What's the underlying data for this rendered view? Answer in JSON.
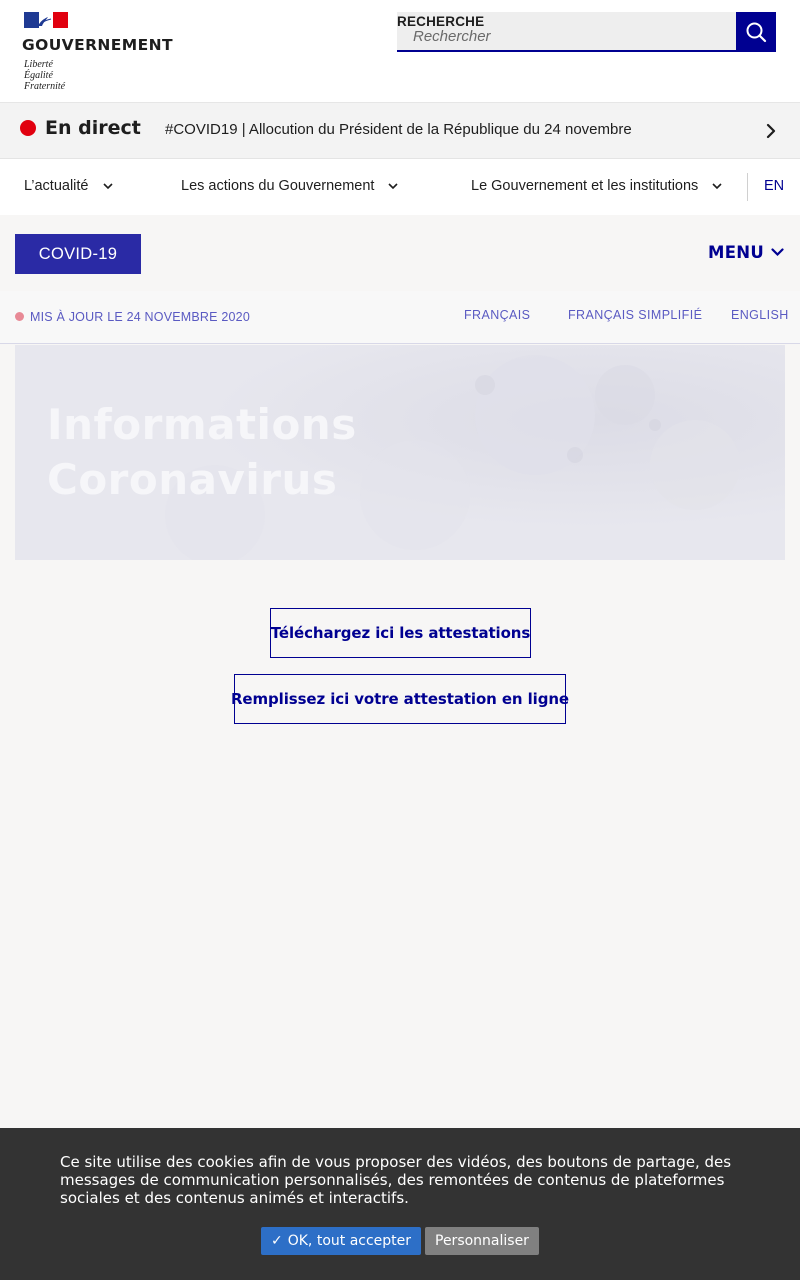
{
  "header": {
    "gov_title": "GOUVERNEMENT",
    "devise": [
      "Liberté",
      "Égalité",
      "Fraternité"
    ],
    "search_label": "RECHERCHE",
    "search_placeholder": "Rechercher",
    "search_icon": "search-icon"
  },
  "live": {
    "label": "En direct",
    "text": "#COVID19 | Allocution du Président de la République du 24 novembre",
    "arrow_icon": "chevron-right-icon",
    "dot_color": "#e1000f"
  },
  "nav": {
    "items": [
      {
        "label": "L’actualité"
      },
      {
        "label": "Les actions du Gouvernement"
      },
      {
        "label": "Le Gouvernement et les institutions"
      }
    ],
    "lang": "EN"
  },
  "covid": {
    "tag_label": "COVID-19",
    "menu_label": "MENU"
  },
  "update": {
    "text": "MIS À JOUR LE 24 NOVEMBRE 2020",
    "languages": [
      "FRANÇAIS",
      "FRANÇAIS SIMPLIFIÉ",
      "ENGLISH"
    ]
  },
  "hero": {
    "title_line1": "Informations",
    "title_line2": "Coronavirus"
  },
  "actions": {
    "download": "Téléchargez ici les attestations",
    "online": "Remplissez ici votre attestation en ligne"
  },
  "cookie": {
    "text": "Ce site utilise des cookies afin de vous proposer des vidéos, des boutons de partage, des messages de communication personnalisés, des remontées de contenus de plateformes sociales et des contenus animés et interactifs.",
    "accept_label": "OK, tout accepter",
    "customize_label": "Personnaliser"
  },
  "colors": {
    "brand_blue": "#000091",
    "brand_red": "#e1000f",
    "covid_tag": "#2a2aa5",
    "cookie_bg": "#333333",
    "accept_btn": "#2d6fc7",
    "customize_btn": "#808080"
  }
}
